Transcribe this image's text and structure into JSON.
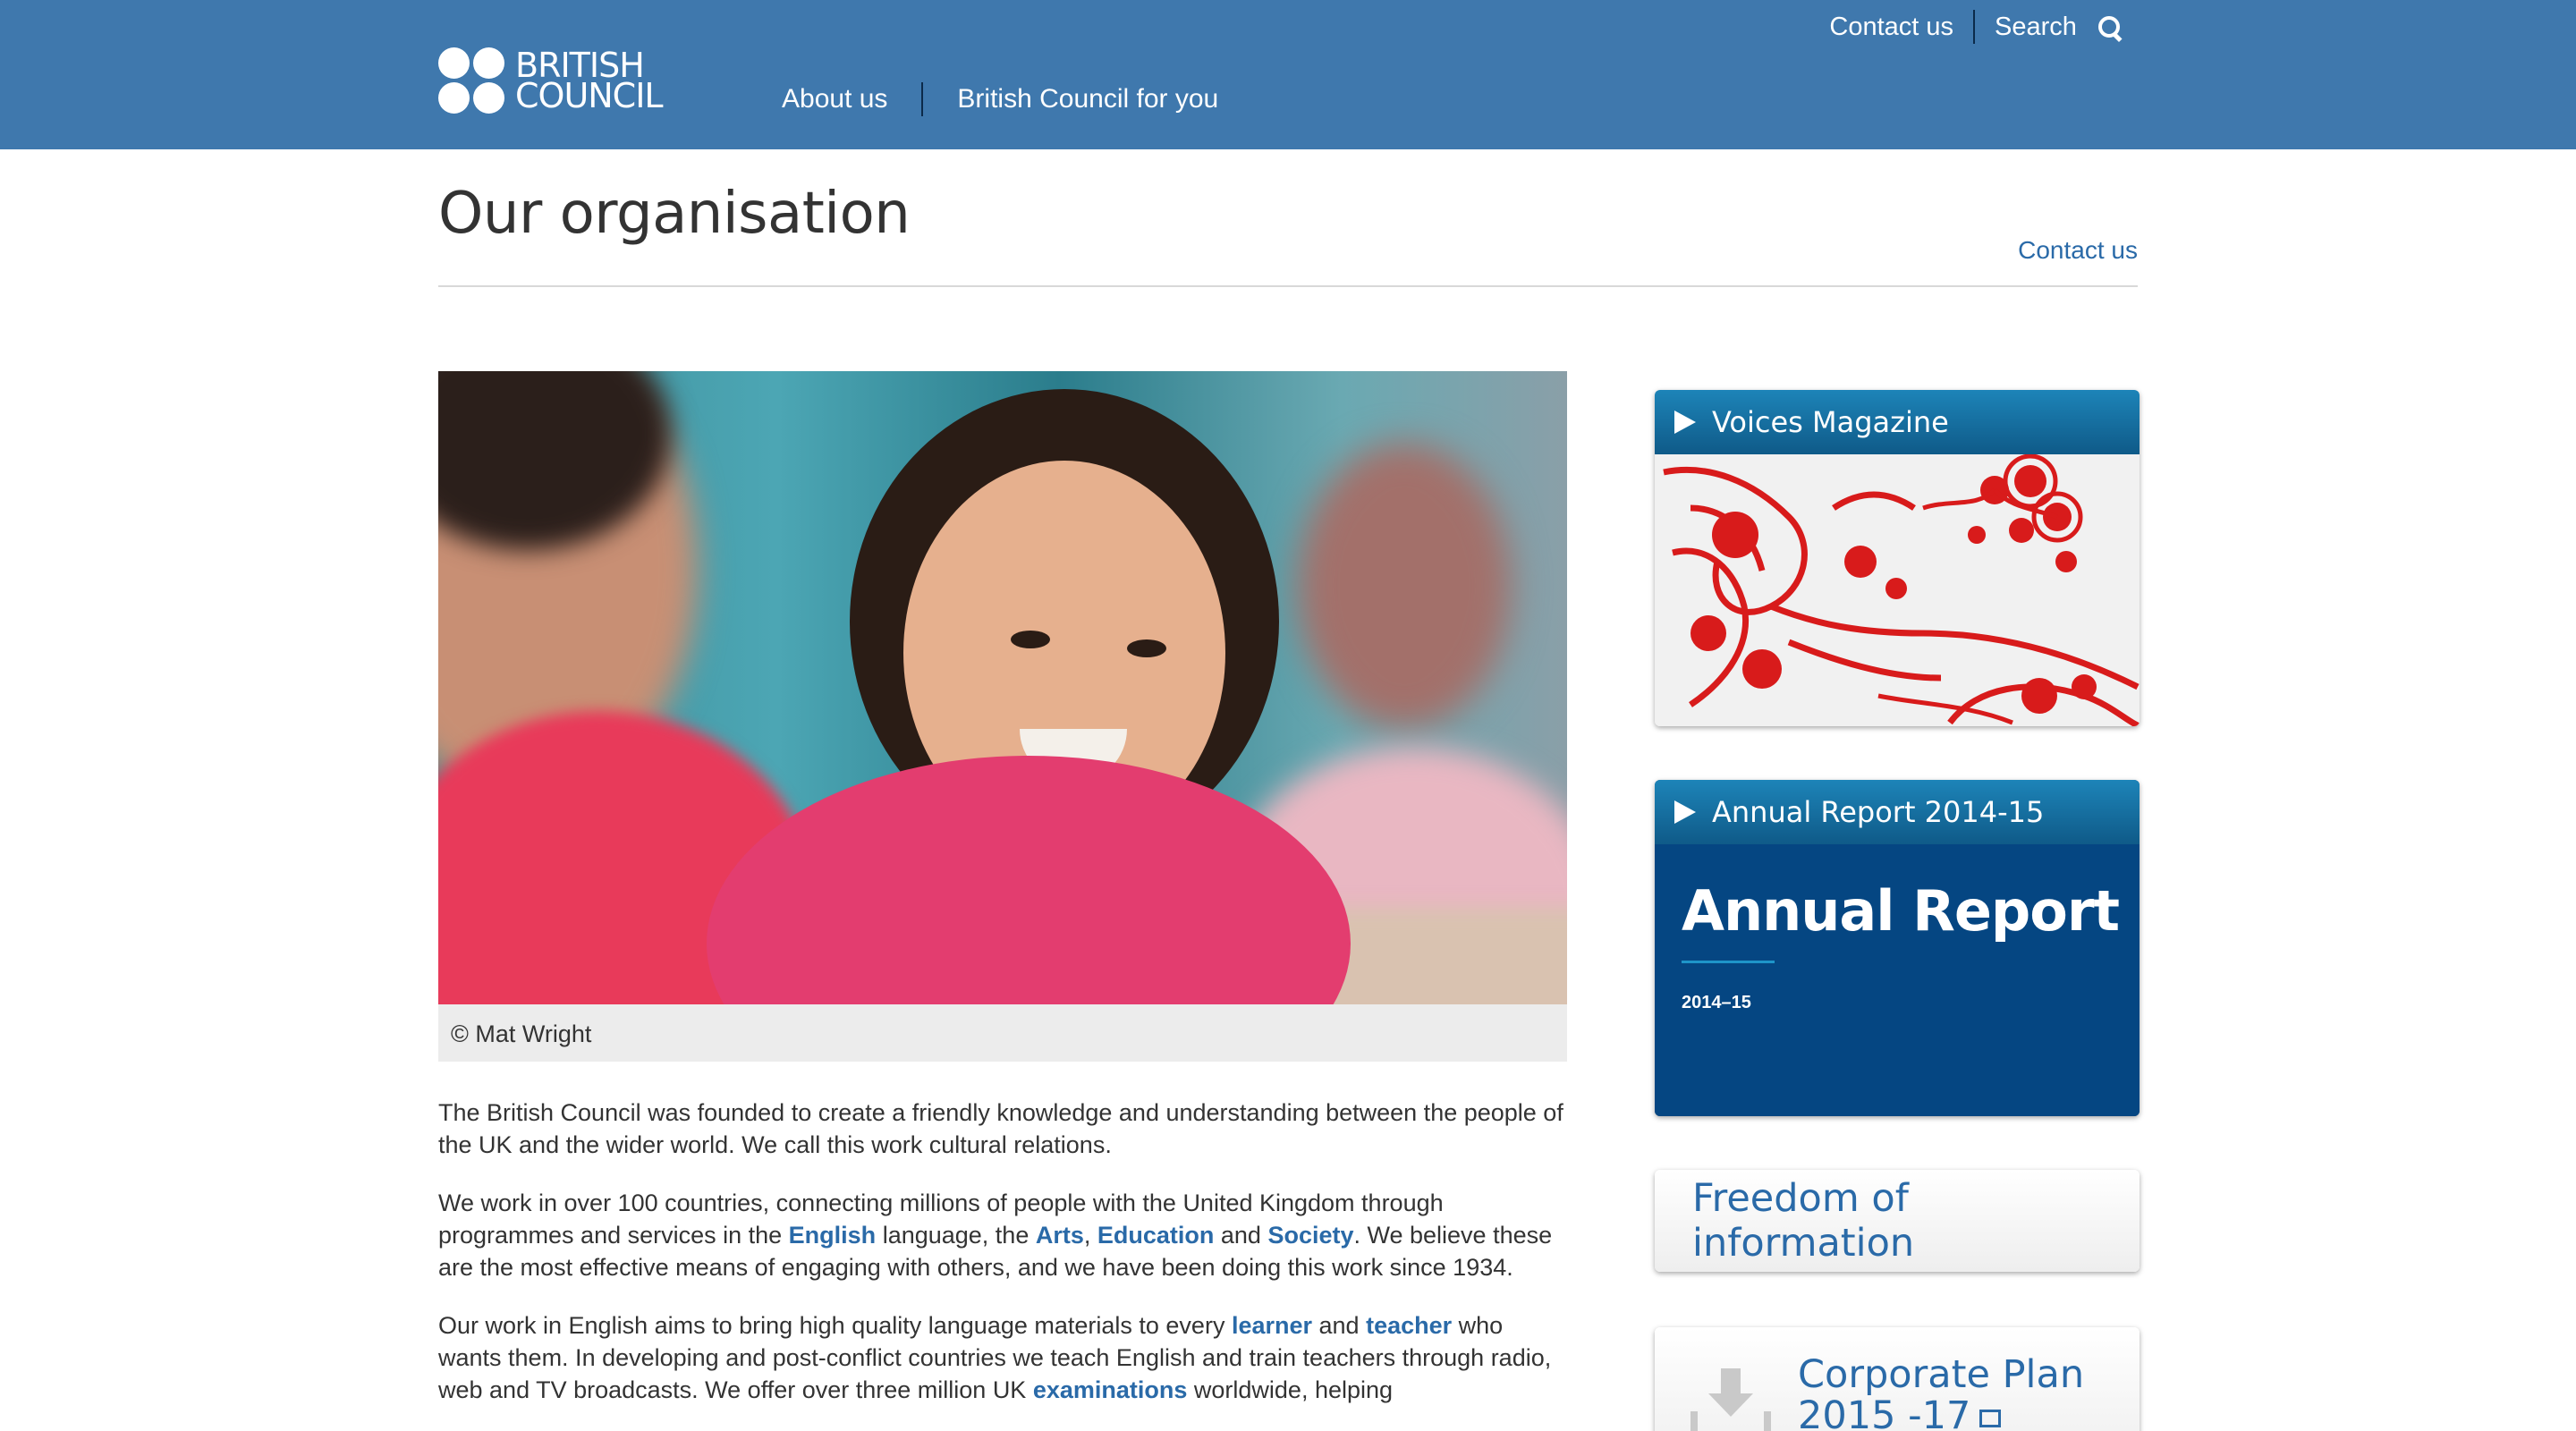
{
  "header": {
    "logo": {
      "line1": "BRITISH",
      "line2": "COUNCIL"
    },
    "utility": {
      "contact": "Contact us",
      "search": "Search"
    },
    "nav": [
      {
        "label": "About us"
      },
      {
        "label": "British Council for you"
      }
    ]
  },
  "page": {
    "title": "Our organisation",
    "contact_link": "Contact us"
  },
  "hero": {
    "caption": "© Mat Wright"
  },
  "body": {
    "p1": "The British Council was founded to create a friendly knowledge and understanding between the people of the UK and the wider world. We call this work cultural relations.",
    "p2_before": "We work in over 100 countries, connecting millions of people with the United Kingdom through programmes and services in the ",
    "link_english": "English",
    "p2_mid1": " language, the ",
    "link_arts": "Arts",
    "p2_comma": ", ",
    "link_education": "Education",
    "p2_and": " and ",
    "link_society": "Society",
    "p2_after": ". We believe these are the most effective means of engaging with others, and we have been doing this work since 1934.",
    "p3_before": "Our work in English aims to bring high quality language materials to every ",
    "link_learner": "learner",
    "p3_and": " and ",
    "link_teacher": "teacher",
    "p3_mid": " who wants them. In developing and post-conflict countries we teach English and train teachers through radio, web and TV broadcasts. We offer over three million UK ",
    "link_examinations": "examinations",
    "p3_after": " worldwide, helping"
  },
  "sidebar": {
    "voices": {
      "title": "Voices Magazine"
    },
    "annual": {
      "title": "Annual Report 2014-15",
      "image_title": "Annual Report",
      "image_year": "2014–15"
    },
    "foi": {
      "title": "Freedom of information"
    },
    "corporate": {
      "line1": "Corporate Plan",
      "line2": "2015 -17"
    }
  },
  "colors": {
    "header_bg": "#3f78ad",
    "link": "#2a6aa8",
    "widget_head": "#1d84b8",
    "annual_bg": "#054682"
  },
  "icons": [
    "search-icon",
    "play-icon",
    "download-icon",
    "external-link-icon"
  ]
}
